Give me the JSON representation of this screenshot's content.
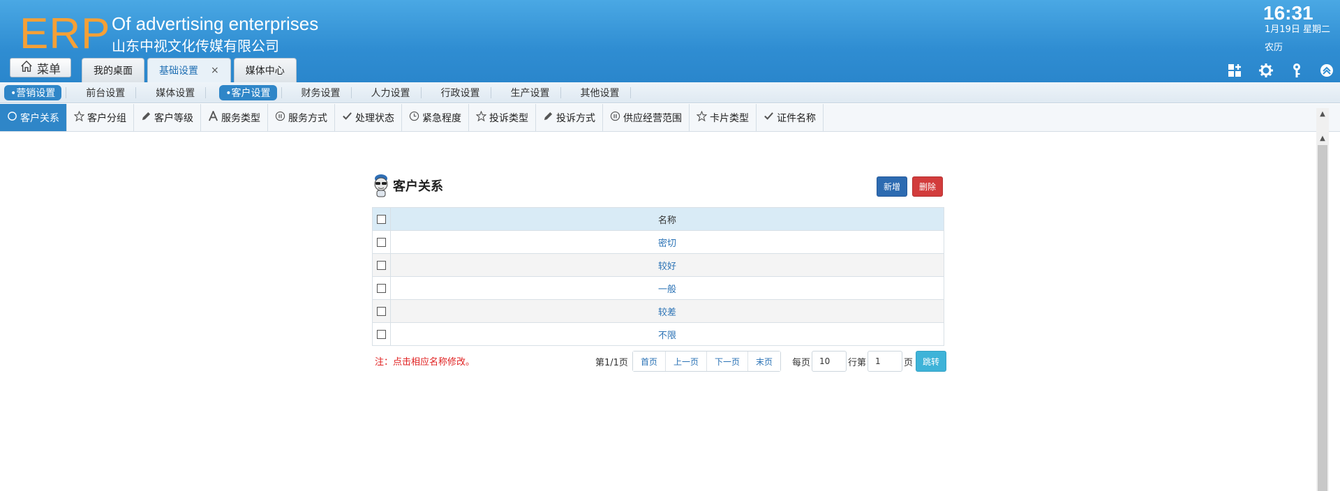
{
  "header": {
    "logo": "ERP",
    "company_en": "Of advertising enterprises",
    "company_cn": "山东中视文化传媒有限公司",
    "menu_label": "菜单",
    "time": "16:31",
    "date": "1月19日 星期二",
    "lunar": "农历",
    "tabs": [
      {
        "label": "我的桌面"
      },
      {
        "label": "基础设置",
        "close": "×"
      },
      {
        "label": "媒体中心"
      }
    ],
    "icons": [
      "apps-icon",
      "gear-icon",
      "key-icon",
      "collapse-icon"
    ]
  },
  "sub_nav": {
    "items": [
      {
        "label": "•营销设置"
      },
      {
        "label": "前台设置"
      },
      {
        "label": "媒体设置"
      },
      {
        "label": "•客户设置"
      },
      {
        "label": "财务设置"
      },
      {
        "label": "人力设置"
      },
      {
        "label": "行政设置"
      },
      {
        "label": "生产设置"
      },
      {
        "label": "其他设置"
      }
    ]
  },
  "third_nav": {
    "items": [
      {
        "label": "客户关系"
      },
      {
        "label": "客户分组"
      },
      {
        "label": "客户等级"
      },
      {
        "label": "服务类型"
      },
      {
        "label": "服务方式"
      },
      {
        "label": "处理状态"
      },
      {
        "label": "紧急程度"
      },
      {
        "label": "投诉类型"
      },
      {
        "label": "投诉方式"
      },
      {
        "label": "供应经营范围"
      },
      {
        "label": "卡片类型"
      },
      {
        "label": "证件名称"
      }
    ]
  },
  "panel": {
    "title": "客户关系",
    "add_label": "新增",
    "delete_label": "删除",
    "column_name": "名称",
    "rows": [
      "密切",
      "较好",
      "一般",
      "较差",
      "不限"
    ],
    "note": "注：点击相应名称修改。"
  },
  "pager": {
    "page_info": "第1/1页",
    "first": "首页",
    "prev": "上一页",
    "next": "下一页",
    "last": "末页",
    "per_page_label": "每页",
    "per_page_value": "10",
    "row_label": "行第",
    "page_value": "1",
    "page_label": "页",
    "jump": "跳转"
  },
  "colors": {
    "header_blue": "#2f8dd2",
    "logo_orange": "#f5a036",
    "active_blue": "#2f86c8",
    "add_button": "#2d6bb1",
    "delete_button": "#d23c3c",
    "jump_button": "#3eb3d8",
    "note_red": "#e02020"
  }
}
